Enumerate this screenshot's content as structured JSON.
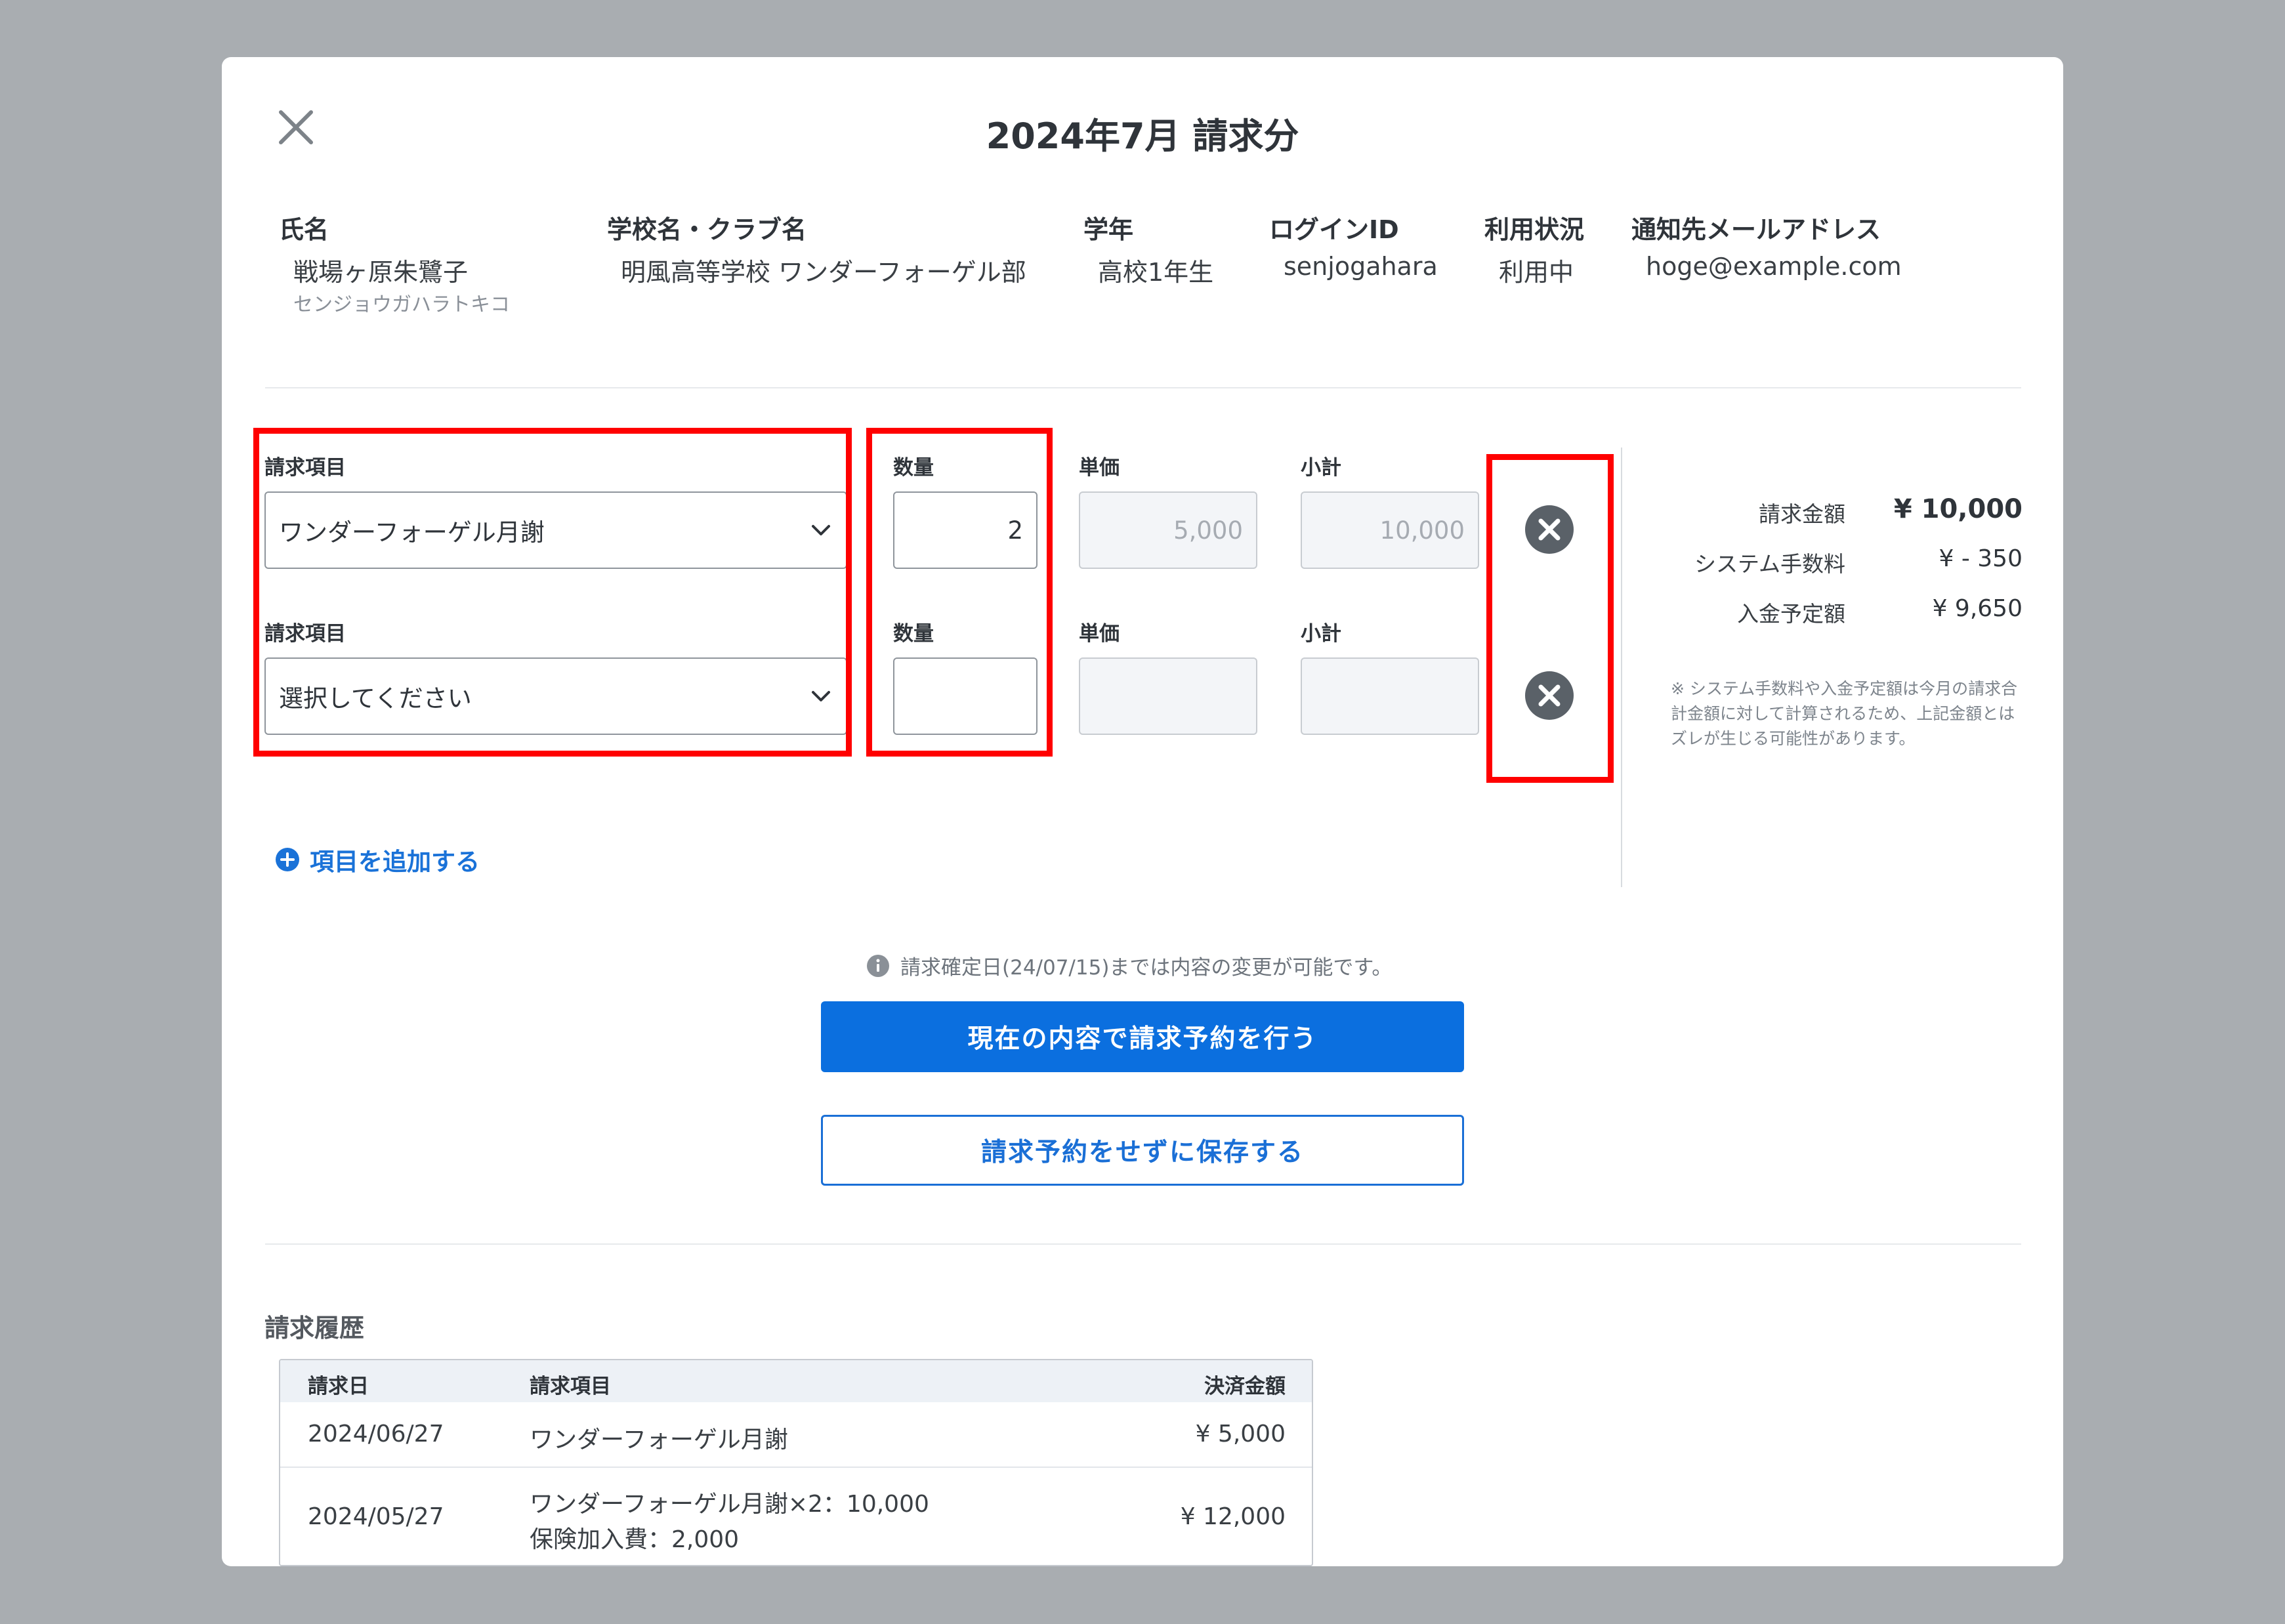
{
  "modal": {
    "title": "2024年7月 請求分",
    "close_icon": "close-icon"
  },
  "info": {
    "name_label": "氏名",
    "name": "戦場ヶ原朱鷺子",
    "name_kana": "センジョウガハラトキコ",
    "school_label": "学校名・クラブ名",
    "school": "明風高等学校 ワンダーフォーゲル部",
    "grade_label": "学年",
    "grade": "高校1年生",
    "login_label": "ログインID",
    "login": "senjogahara",
    "status_label": "利用状況",
    "status": "利用中",
    "email_label": "通知先メールアドレス",
    "email": "hoge@example.com"
  },
  "items": [
    {
      "item_label": "請求項目",
      "item_value": "ワンダーフォーゲル月謝",
      "qty_label": "数量",
      "qty_value": "2",
      "price_label": "単価",
      "price_value": "5,000",
      "subtotal_label": "小計",
      "subtotal_value": "10,000"
    },
    {
      "item_label": "請求項目",
      "item_value": "選択してください",
      "qty_label": "数量",
      "qty_value": "",
      "price_label": "単価",
      "price_value": "",
      "subtotal_label": "小計",
      "subtotal_value": ""
    }
  ],
  "add_item_label": "項目を追加する",
  "summary": {
    "billing_label": "請求金額",
    "billing_value": "¥ 10,000",
    "fee_label": "システム手数料",
    "fee_value": "¥ - 350",
    "deposit_label": "入金予定額",
    "deposit_value": "¥ 9,650",
    "note": "※ システム手数料や入金予定額は今月の請求合計金額に対して計算されるため、上記金額とはズレが生じる可能性があります。"
  },
  "notice": "請求確定日(24/07/15)までは内容の変更が可能です。",
  "buttons": {
    "reserve": "現在の内容で請求予約を行う",
    "save": "請求予約をせずに保存する"
  },
  "history": {
    "title": "請求履歴",
    "headers": [
      "請求日",
      "請求項目",
      "決済金額"
    ],
    "rows": [
      {
        "date": "2024/06/27",
        "item_line1": "ワンダーフォーゲル月謝",
        "item_line2": "",
        "amount": "¥ 5,000"
      },
      {
        "date": "2024/05/27",
        "item_line1": "ワンダーフォーゲル月謝×2：10,000",
        "item_line2": "保険加入費：2,000",
        "amount": "¥ 12,000"
      }
    ]
  },
  "colors": {
    "primary": "#0b6fdf",
    "highlight": "#ff0000",
    "backdrop": "#a9adb1"
  }
}
